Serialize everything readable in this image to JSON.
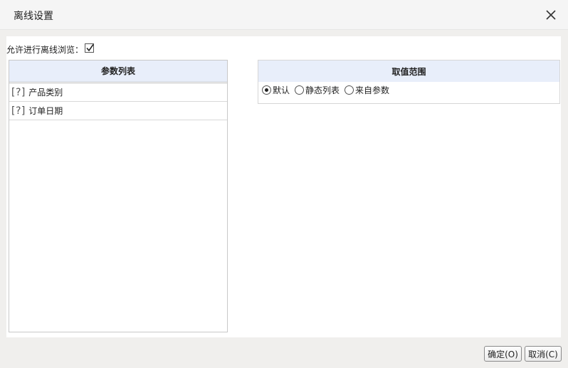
{
  "dialog": {
    "title": "离线设置",
    "close_icon": "close-icon"
  },
  "options": {
    "allow_offline_label": "允许进行离线浏览：",
    "allow_offline_checked": true
  },
  "param_list": {
    "header": "参数列表",
    "items": [
      {
        "icon": "[?]",
        "label": "产品类别"
      },
      {
        "icon": "[?]",
        "label": "订单日期"
      }
    ]
  },
  "value_range": {
    "header": "取值范围",
    "selected": "默认",
    "options": [
      "默认",
      "静态列表",
      "来自参数"
    ]
  },
  "buttons": {
    "ok_label": "确定(O)",
    "cancel_label": "取消(C)"
  },
  "colors": {
    "header_bg": "#e8eefa",
    "dialog_bg": "#f0efed"
  }
}
